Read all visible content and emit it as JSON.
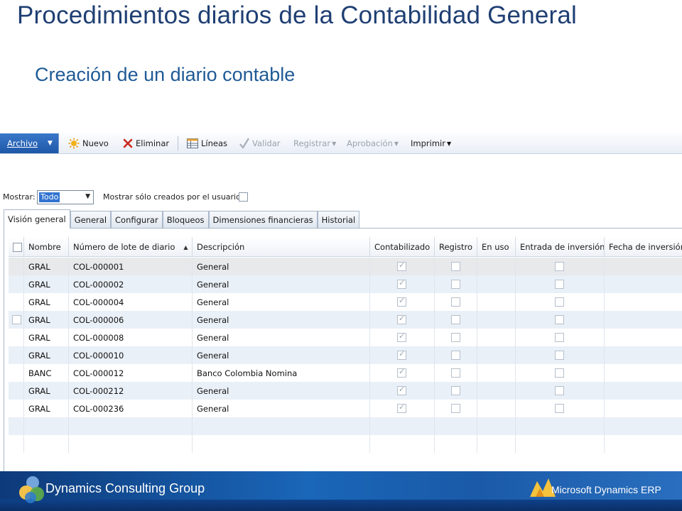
{
  "slide": {
    "title": "Procedimientos diarios de la Contabilidad General",
    "subtitle": "Creación de un diario contable"
  },
  "toolbar": {
    "archivo": "Archivo",
    "nuevo": "Nuevo",
    "eliminar": "Eliminar",
    "lineas": "Líneas",
    "validar": "Validar",
    "registrar": "Registrar",
    "aprobacion": "Aprobación",
    "imprimir": "Imprimir"
  },
  "filter": {
    "mostrar_label": "Mostrar:",
    "mostrar_value": "Todo",
    "user_only_label": "Mostrar sólo creados por el usuario:"
  },
  "tabs": [
    "Visión general",
    "General",
    "Configurar",
    "Bloqueos",
    "Dimensiones financieras",
    "Historial"
  ],
  "columns": {
    "nombre": "Nombre",
    "lote": "Número de lote de diario",
    "descripcion": "Descripción",
    "contabilizado": "Contabilizado",
    "registro": "Registro",
    "en_uso": "En uso",
    "entrada": "Entrada de inversión",
    "fecha": "Fecha de inversión"
  },
  "rows": [
    {
      "nombre": "GRAL",
      "lote": "COL-000001",
      "descripcion": "General"
    },
    {
      "nombre": "GRAL",
      "lote": "COL-000002",
      "descripcion": "General"
    },
    {
      "nombre": "GRAL",
      "lote": "COL-000004",
      "descripcion": "General"
    },
    {
      "nombre": "GRAL",
      "lote": "COL-000006",
      "descripcion": "General"
    },
    {
      "nombre": "GRAL",
      "lote": "COL-000008",
      "descripcion": "General"
    },
    {
      "nombre": "GRAL",
      "lote": "COL-000010",
      "descripcion": "General"
    },
    {
      "nombre": "BANC",
      "lote": "COL-000012",
      "descripcion": "Banco Colombia Nomina"
    },
    {
      "nombre": "GRAL",
      "lote": "COL-000212",
      "descripcion": "General"
    },
    {
      "nombre": "GRAL",
      "lote": "COL-000236",
      "descripcion": "General"
    }
  ],
  "footer": {
    "company": "Dynamics Consulting Group",
    "brand": "Microsoft Dynamics ERP"
  },
  "colors": {
    "title": "#1f3f73",
    "subtitle": "#1f5a96",
    "archivo_button": "#1d57a8",
    "selection": "#3173d0",
    "footer": "#1a66b8"
  }
}
